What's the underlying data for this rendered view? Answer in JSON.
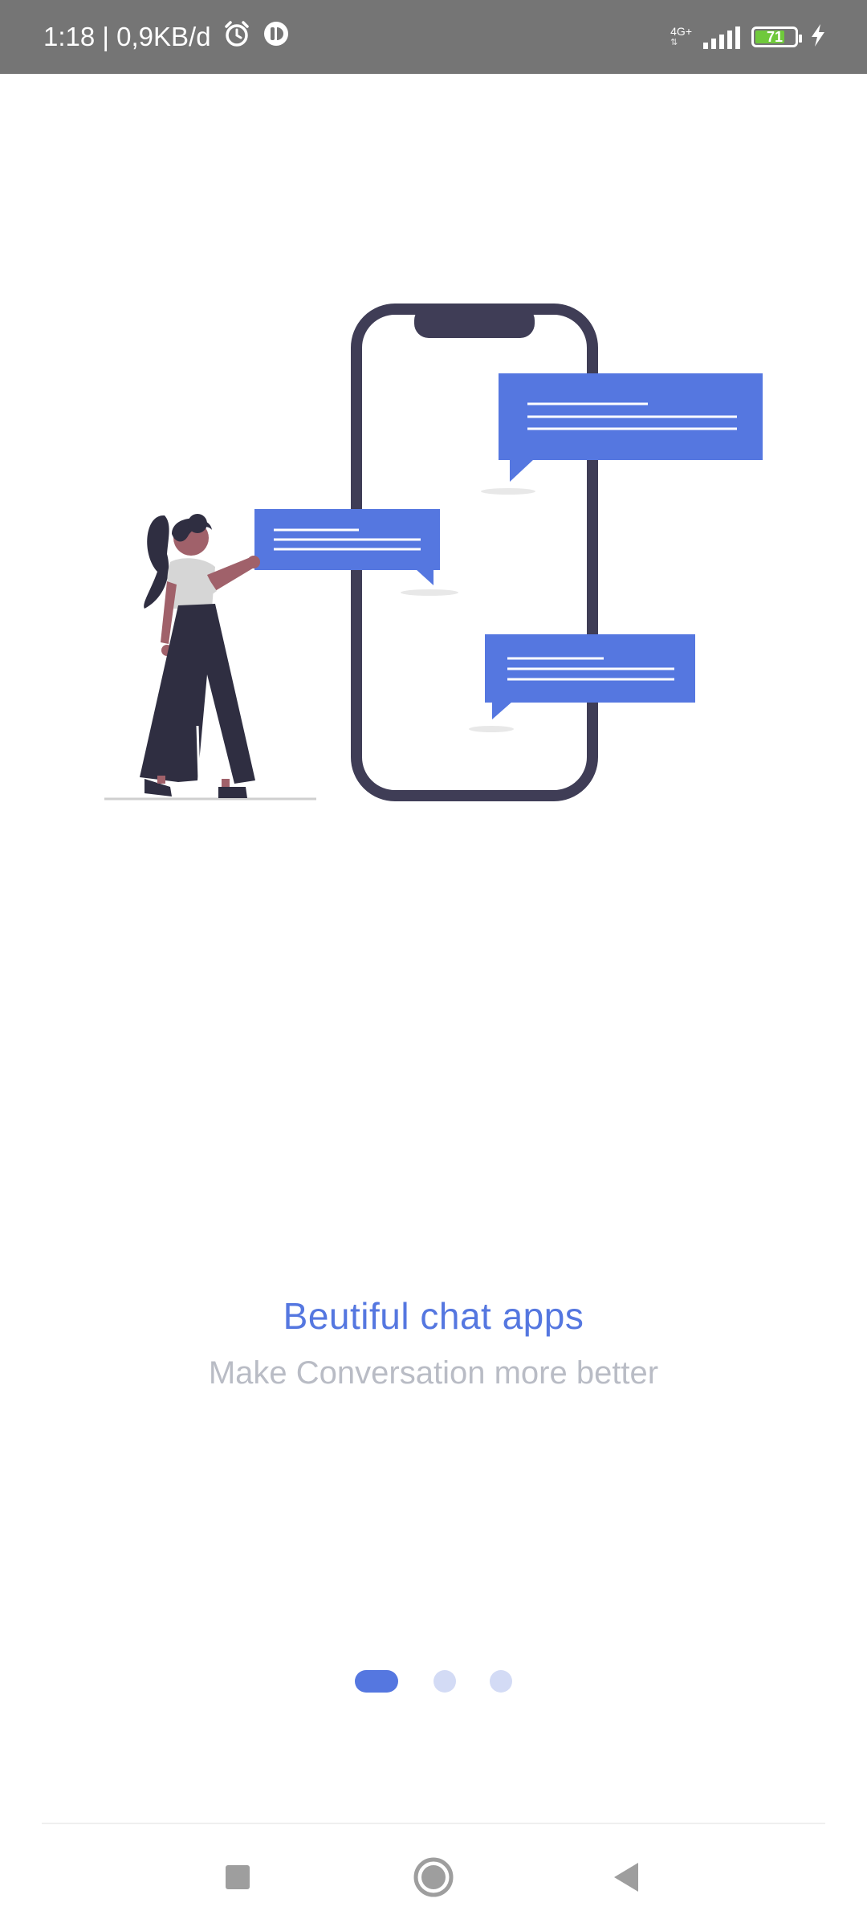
{
  "status_bar": {
    "time_speed": "1:18 | 0,9KB/d",
    "network": "4G+",
    "battery_level": "71",
    "icons": [
      "alarm-icon",
      "app-notification-icon",
      "signal-icon",
      "battery-icon",
      "charging-icon"
    ]
  },
  "onboarding": {
    "title": "Beutiful chat apps",
    "subtitle": "Make Conversation more better",
    "page_indicator": {
      "pages": 3,
      "active": 1
    }
  },
  "colors": {
    "accent": "#5577e0",
    "dot_inactive": "#d3dbf5",
    "phone_outline": "#3f3d56",
    "subtitle_text": "#b9bcc5"
  },
  "nav_bar": {
    "icons": [
      "recent-apps-icon",
      "home-icon",
      "back-icon"
    ]
  }
}
